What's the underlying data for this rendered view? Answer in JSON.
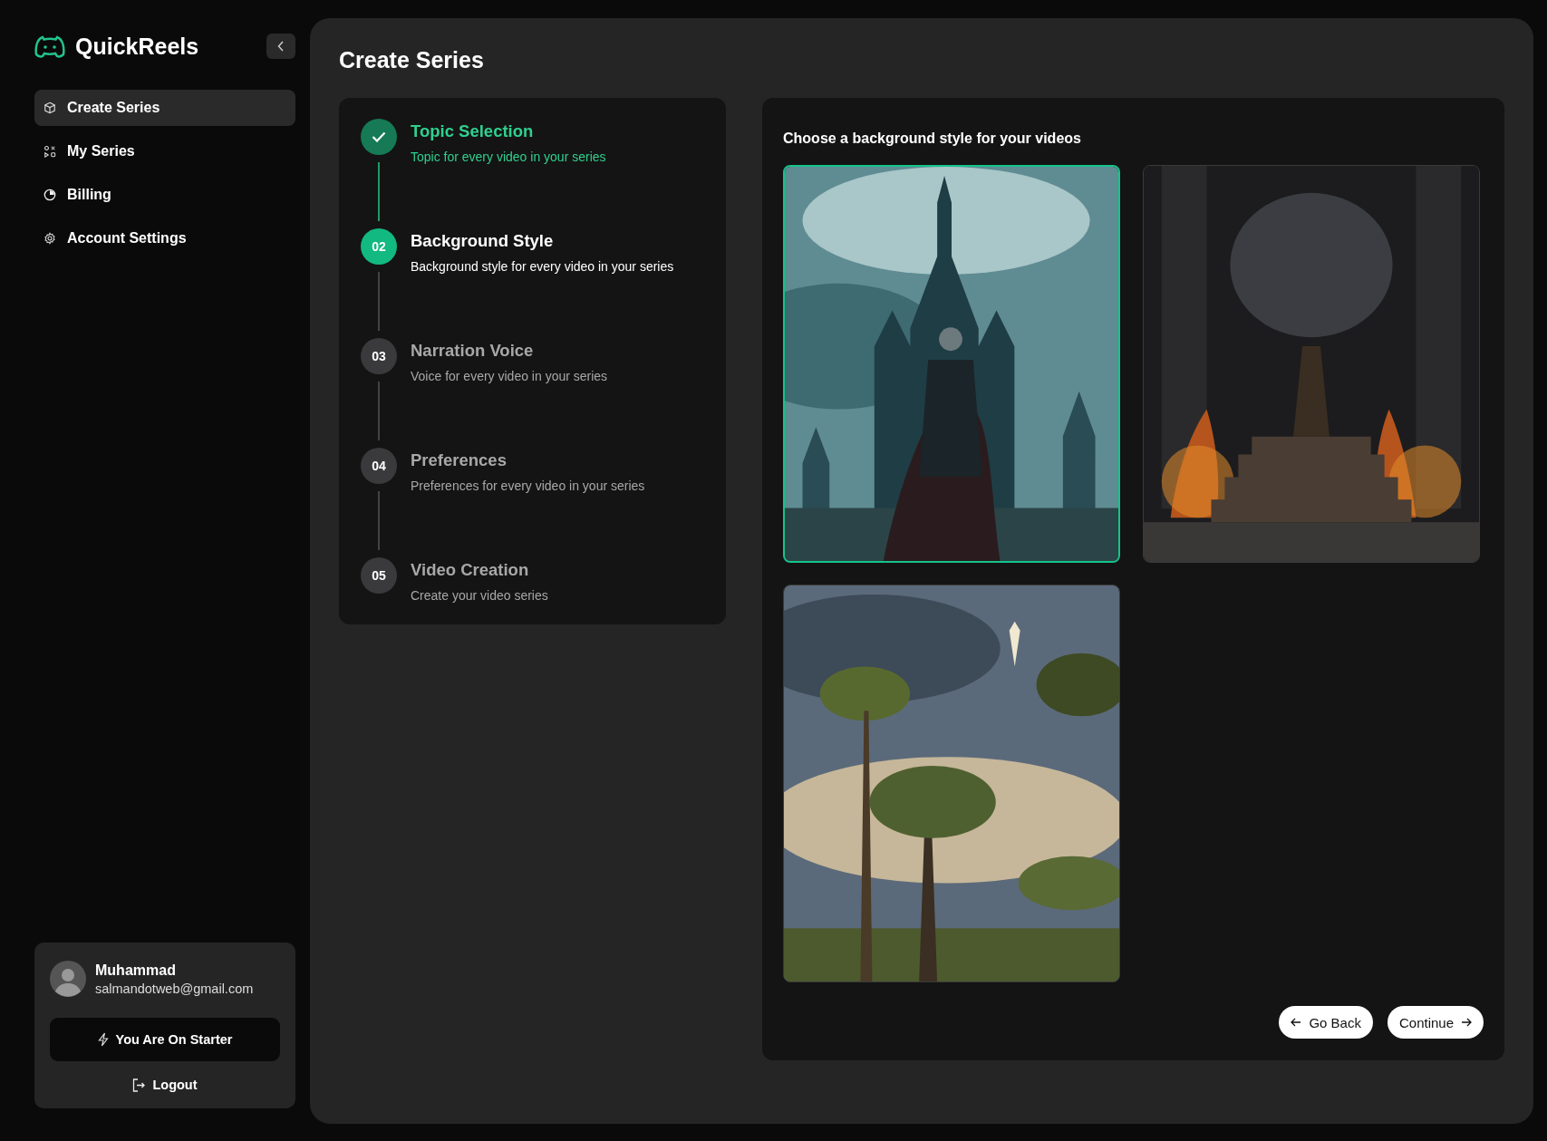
{
  "brand": {
    "name": "QuickReels"
  },
  "sidebar": {
    "items": [
      {
        "label": "Create Series",
        "selected": true
      },
      {
        "label": "My Series",
        "selected": false
      },
      {
        "label": "Billing",
        "selected": false
      },
      {
        "label": "Account Settings",
        "selected": false
      }
    ]
  },
  "user": {
    "name": "Muhammad",
    "email": "salmandotweb@gmail.com",
    "plan_button": "You Are On Starter",
    "logout": "Logout"
  },
  "page": {
    "title": "Create Series"
  },
  "steps": [
    {
      "title": "Topic Selection",
      "subtitle": "Topic for every video in your series",
      "completed": true,
      "selected": false
    },
    {
      "number": "02",
      "title": "Background Style",
      "subtitle": "Background style for every video in your series",
      "completed": false,
      "selected": true
    },
    {
      "number": "03",
      "title": "Narration Voice",
      "subtitle": "Voice for every video in your series",
      "completed": false,
      "selected": false
    },
    {
      "number": "04",
      "title": "Preferences",
      "subtitle": "Preferences for every video in your series",
      "completed": false,
      "selected": false
    },
    {
      "number": "05",
      "title": "Video Creation",
      "subtitle": "Create your video series",
      "completed": false,
      "selected": false
    }
  ],
  "background_picker": {
    "heading": "Choose a background style for your videos",
    "options": [
      {
        "kind": "picture",
        "selected": true
      },
      {
        "kind": "picture",
        "selected": false
      },
      {
        "kind": "picture",
        "selected": false
      }
    ]
  },
  "buttons": [
    {
      "label": "Go Back",
      "kind": "back"
    },
    {
      "label": "Continue",
      "kind": "next"
    }
  ]
}
